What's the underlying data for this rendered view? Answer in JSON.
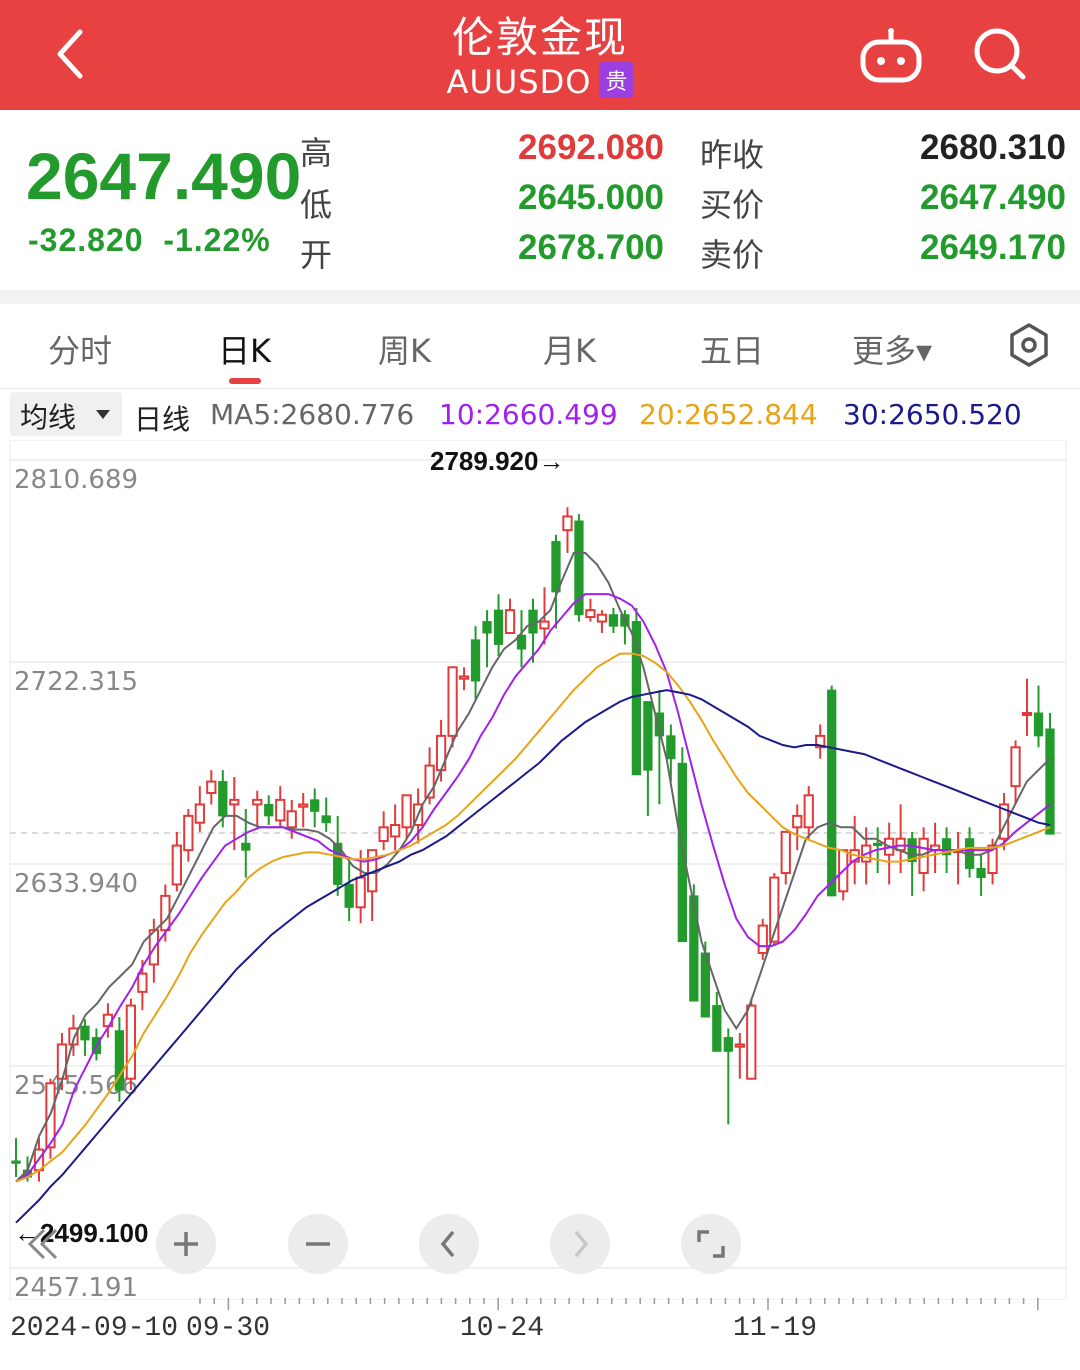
{
  "header": {
    "title": "伦敦金现",
    "code": "AUUSDO",
    "badge": "贵",
    "bg_color": "#e84141"
  },
  "quote": {
    "price": "2647.490",
    "change": "-32.820",
    "change_pct": "-1.22%",
    "labels": {
      "high": "高",
      "low": "低",
      "open": "开",
      "prev_close": "昨收",
      "bid": "买价",
      "ask": "卖价"
    },
    "high": "2692.080",
    "low": "2645.000",
    "open": "2678.700",
    "prev_close": "2680.310",
    "bid": "2647.490",
    "ask": "2649.170",
    "up_color": "#e03b3b",
    "down_color": "#229a2c"
  },
  "tabs": [
    {
      "label": "分时",
      "active": false
    },
    {
      "label": "日K",
      "active": true
    },
    {
      "label": "周K",
      "active": false
    },
    {
      "label": "月K",
      "active": false
    },
    {
      "label": "五日",
      "active": false
    },
    {
      "label": "更多▾",
      "active": false
    }
  ],
  "ma_bar": {
    "selector": "均线",
    "period": "日线",
    "ma5": "MA5:2680.776",
    "ma10": "10:2660.499",
    "ma20": "20:2652.844",
    "ma30": "30:2650.520",
    "colors": {
      "ma5": "#666666",
      "ma10": "#a020f0",
      "ma20": "#e8a317",
      "ma30": "#1a1a8c"
    }
  },
  "chart_data": {
    "type": "candlestick",
    "y_tick_labels": [
      "2810.689",
      "2722.315",
      "2633.940",
      "2545.566",
      "2457.191"
    ],
    "y_ticks": [
      2810.689,
      2722.315,
      2633.94,
      2545.566,
      2457.191
    ],
    "ylim": [
      2457.191,
      2810.689
    ],
    "max_label": "2789.920→",
    "min_label": "←2499.100",
    "x_labels": [
      "2024-09-10",
      "09-30",
      "10-24",
      "11-19"
    ],
    "last_close_dashed": 2647.49,
    "candles": [
      [
        2504,
        2514,
        2497,
        2503
      ],
      [
        2500,
        2506,
        2495,
        2497
      ],
      [
        2500,
        2514,
        2495,
        2509
      ],
      [
        2510,
        2540,
        2505,
        2538
      ],
      [
        2540,
        2560,
        2535,
        2555
      ],
      [
        2555,
        2568,
        2550,
        2562
      ],
      [
        2563,
        2566,
        2550,
        2557
      ],
      [
        2558,
        2562,
        2548,
        2551
      ],
      [
        2563,
        2573,
        2558,
        2568
      ],
      [
        2561,
        2567,
        2530,
        2535
      ],
      [
        2540,
        2575,
        2535,
        2572
      ],
      [
        2578,
        2592,
        2570,
        2586
      ],
      [
        2590,
        2610,
        2582,
        2605
      ],
      [
        2605,
        2625,
        2600,
        2620
      ],
      [
        2625,
        2648,
        2622,
        2642
      ],
      [
        2640,
        2658,
        2635,
        2655
      ],
      [
        2652,
        2668,
        2648,
        2660
      ],
      [
        2665,
        2675,
        2660,
        2670
      ],
      [
        2670,
        2675,
        2650,
        2655
      ],
      [
        2660,
        2672,
        2640,
        2662
      ],
      [
        2643,
        2658,
        2628,
        2640
      ],
      [
        2660,
        2666,
        2650,
        2662
      ],
      [
        2660,
        2664,
        2651,
        2655
      ],
      [
        2653,
        2668,
        2650,
        2662
      ],
      [
        2650,
        2662,
        2645,
        2657
      ],
      [
        2659,
        2665,
        2650,
        2660
      ],
      [
        2662,
        2667,
        2650,
        2657
      ],
      [
        2655,
        2663,
        2648,
        2652
      ],
      [
        2643,
        2655,
        2620,
        2625
      ],
      [
        2625,
        2635,
        2609,
        2615
      ],
      [
        2615,
        2640,
        2608,
        2628
      ],
      [
        2622,
        2640,
        2609,
        2640
      ],
      [
        2644,
        2657,
        2640,
        2650
      ],
      [
        2646,
        2660,
        2640,
        2651
      ],
      [
        2650,
        2663,
        2645,
        2664
      ],
      [
        2651,
        2667,
        2643,
        2660
      ],
      [
        2663,
        2685,
        2660,
        2677
      ],
      [
        2675,
        2697,
        2670,
        2690
      ],
      [
        2690,
        2715,
        2685,
        2720
      ],
      [
        2715,
        2720,
        2710,
        2716
      ],
      [
        2732,
        2738,
        2706,
        2714
      ],
      [
        2740,
        2745,
        2720,
        2735
      ],
      [
        2745,
        2752,
        2725,
        2730
      ],
      [
        2735,
        2750,
        2735,
        2745
      ],
      [
        2734,
        2745,
        2720,
        2728
      ],
      [
        2745,
        2750,
        2722,
        2735
      ],
      [
        2737,
        2755,
        2730,
        2740
      ],
      [
        2775,
        2778,
        2737,
        2753
      ],
      [
        2780,
        2790,
        2770,
        2786
      ],
      [
        2784,
        2787,
        2740,
        2743
      ],
      [
        2742,
        2750,
        2740,
        2745
      ],
      [
        2740,
        2745,
        2735,
        2743
      ],
      [
        2743,
        2746,
        2735,
        2738
      ],
      [
        2743,
        2745,
        2730,
        2738
      ],
      [
        2740,
        2746,
        2673,
        2673
      ],
      [
        2705,
        2700,
        2655,
        2675
      ],
      [
        2700,
        2710,
        2660,
        2690
      ],
      [
        2690,
        2695,
        2670,
        2680
      ],
      [
        2678,
        2685,
        2620,
        2600
      ],
      [
        2620,
        2625,
        2574,
        2574
      ],
      [
        2595,
        2600,
        2567,
        2567
      ],
      [
        2572,
        2578,
        2556,
        2552
      ],
      [
        2558,
        2562,
        2520,
        2552
      ],
      [
        2554,
        2560,
        2540,
        2555
      ],
      [
        2540,
        2575,
        2540,
        2572
      ],
      [
        2595,
        2610,
        2592,
        2607
      ],
      [
        2600,
        2630,
        2598,
        2628
      ],
      [
        2630,
        2645,
        2625,
        2648
      ],
      [
        2650,
        2660,
        2640,
        2655
      ],
      [
        2650,
        2668,
        2645,
        2664
      ],
      [
        2685,
        2695,
        2680,
        2690
      ],
      [
        2710,
        2712,
        2660,
        2620
      ],
      [
        2622,
        2640,
        2618,
        2640
      ],
      [
        2635,
        2655,
        2625,
        2640
      ],
      [
        2635,
        2650,
        2625,
        2642
      ],
      [
        2643,
        2650,
        2630,
        2642
      ],
      [
        2638,
        2652,
        2625,
        2645
      ],
      [
        2640,
        2660,
        2630,
        2645
      ],
      [
        2645,
        2648,
        2620,
        2635
      ],
      [
        2630,
        2650,
        2622,
        2645
      ],
      [
        2640,
        2652,
        2630,
        2642
      ],
      [
        2645,
        2650,
        2630,
        2638
      ],
      [
        2640,
        2648,
        2625,
        2640
      ],
      [
        2645,
        2650,
        2628,
        2632
      ],
      [
        2632,
        2638,
        2620,
        2628
      ],
      [
        2630,
        2645,
        2625,
        2642
      ],
      [
        2645,
        2665,
        2640,
        2660
      ],
      [
        2668,
        2688,
        2660,
        2685
      ],
      [
        2700,
        2715,
        2690,
        2700
      ],
      [
        2700,
        2712,
        2685,
        2690
      ],
      [
        2693,
        2700,
        2647,
        2647
      ]
    ],
    "ma5": [
      2495,
      2500,
      2515,
      2525,
      2540,
      2558,
      2568,
      2573,
      2580,
      2585,
      2590,
      2600,
      2605,
      2610,
      2620,
      2630,
      2640,
      2650,
      2655,
      2655,
      2652,
      2650,
      2650,
      2650,
      2649,
      2649,
      2648,
      2645,
      2640,
      2633,
      2630,
      2630,
      2634,
      2640,
      2648,
      2660,
      2668,
      2680,
      2692,
      2700,
      2710,
      2720,
      2728,
      2732,
      2738,
      2740,
      2745,
      2758,
      2770,
      2770,
      2765,
      2757,
      2745,
      2735,
      2720,
      2700,
      2680,
      2650,
      2625,
      2600,
      2585,
      2570,
      2562,
      2570,
      2585,
      2600,
      2615,
      2630,
      2645,
      2650,
      2652,
      2650,
      2650,
      2645,
      2645,
      2642,
      2640,
      2638,
      2638,
      2640,
      2640,
      2640,
      2638,
      2638,
      2640,
      2650,
      2660,
      2670,
      2675,
      2680
    ],
    "ma10": [
      2495,
      2498,
      2505,
      2512,
      2520,
      2535,
      2545,
      2555,
      2563,
      2572,
      2580,
      2590,
      2598,
      2605,
      2612,
      2620,
      2628,
      2635,
      2642,
      2645,
      2648,
      2650,
      2650,
      2650,
      2648,
      2646,
      2644,
      2640,
      2638,
      2636,
      2635,
      2636,
      2638,
      2640,
      2644,
      2650,
      2658,
      2665,
      2672,
      2680,
      2690,
      2698,
      2708,
      2716,
      2722,
      2728,
      2736,
      2742,
      2748,
      2752,
      2752,
      2752,
      2750,
      2747,
      2740,
      2730,
      2718,
      2700,
      2680,
      2660,
      2642,
      2625,
      2610,
      2602,
      2598,
      2598,
      2600,
      2605,
      2612,
      2620,
      2625,
      2630,
      2635,
      2638,
      2640,
      2641,
      2642,
      2642,
      2641,
      2640,
      2640,
      2640,
      2640,
      2640,
      2640,
      2643,
      2648,
      2652,
      2656,
      2660
    ],
    "ma20": [
      2495,
      2497,
      2500,
      2504,
      2508,
      2514,
      2520,
      2527,
      2534,
      2542,
      2550,
      2560,
      2568,
      2576,
      2585,
      2595,
      2603,
      2610,
      2617,
      2622,
      2628,
      2632,
      2635,
      2637,
      2638,
      2639,
      2639,
      2638,
      2637,
      2636,
      2636,
      2637,
      2638,
      2640,
      2642,
      2645,
      2648,
      2651,
      2655,
      2660,
      2665,
      2670,
      2675,
      2680,
      2686,
      2692,
      2698,
      2704,
      2710,
      2715,
      2720,
      2723,
      2726,
      2726,
      2725,
      2722,
      2718,
      2712,
      2705,
      2697,
      2688,
      2680,
      2672,
      2665,
      2660,
      2655,
      2650,
      2647,
      2645,
      2643,
      2641,
      2640,
      2638,
      2637,
      2636,
      2635,
      2635,
      2636,
      2637,
      2638,
      2639,
      2640,
      2641,
      2641,
      2641,
      2642,
      2644,
      2646,
      2648,
      2650
    ],
    "ma30": [
      2477,
      2482,
      2487,
      2493,
      2498,
      2504,
      2510,
      2516,
      2522,
      2528,
      2534,
      2540,
      2546,
      2552,
      2558,
      2564,
      2570,
      2576,
      2582,
      2588,
      2593,
      2598,
      2603,
      2607,
      2611,
      2615,
      2618,
      2621,
      2624,
      2627,
      2629,
      2631,
      2633,
      2635,
      2638,
      2640,
      2643,
      2646,
      2650,
      2654,
      2658,
      2662,
      2666,
      2670,
      2674,
      2678,
      2683,
      2688,
      2692,
      2696,
      2699,
      2702,
      2705,
      2707,
      2708,
      2709,
      2710,
      2709,
      2708,
      2706,
      2703,
      2700,
      2697,
      2694,
      2690,
      2688,
      2686,
      2685,
      2686,
      2686,
      2685,
      2684,
      2683,
      2682,
      2680,
      2678,
      2676,
      2674,
      2672,
      2670,
      2668,
      2666,
      2664,
      2662,
      2660,
      2658,
      2656,
      2654,
      2652,
      2651
    ]
  },
  "controls": [
    {
      "name": "collapse-button",
      "glyph": "«"
    },
    {
      "name": "zoom-in-button",
      "glyph": "+"
    },
    {
      "name": "zoom-out-button",
      "glyph": "−"
    },
    {
      "name": "pan-left-button",
      "glyph": "‹"
    },
    {
      "name": "pan-right-button",
      "glyph": "›"
    },
    {
      "name": "fullscreen-button",
      "glyph": "⤢"
    }
  ]
}
